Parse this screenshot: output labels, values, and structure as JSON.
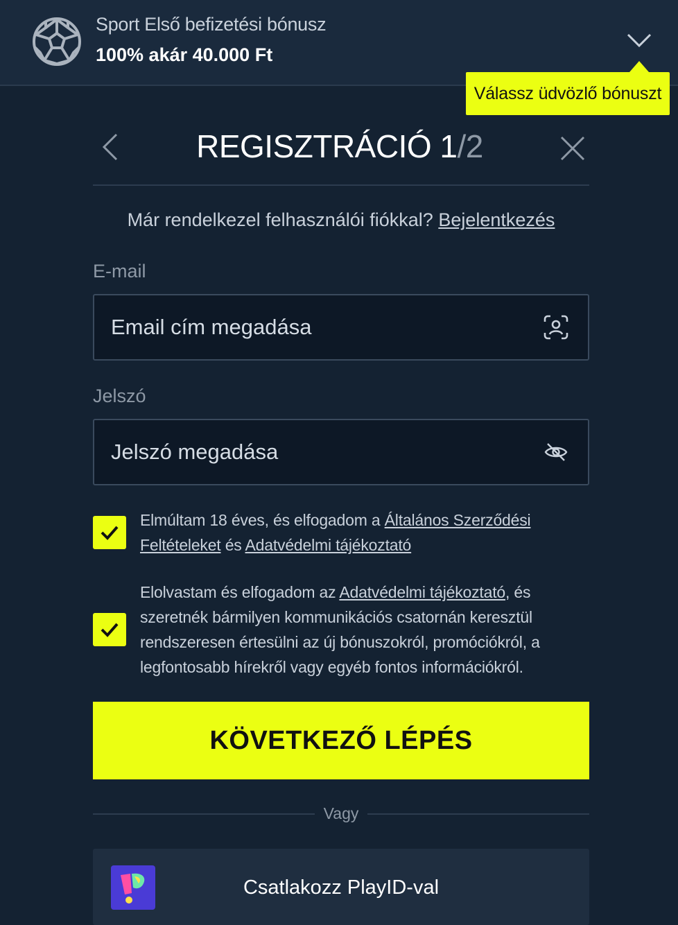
{
  "bonus_banner": {
    "title": "Sport Első befizetési bónusz",
    "amount": "100% akár 40.000 Ft",
    "icon": "soccer-ball-icon",
    "expand_icon": "chevron-down-icon"
  },
  "tooltip": {
    "text": "Válassz üdvözlő bónuszt"
  },
  "header": {
    "title_main": "REGISZTRÁCIÓ 1",
    "title_total": "/2",
    "back_icon": "chevron-left-icon",
    "close_icon": "close-icon"
  },
  "login_prompt": {
    "text": "Már rendelkezel felhasználói fiókkal?",
    "link": "Bejelentkezés"
  },
  "email": {
    "label": "E-mail",
    "placeholder": "Email cím megadása",
    "icon": "face-scan-icon"
  },
  "password": {
    "label": "Jelszó",
    "placeholder": "Jelszó megadása",
    "icon": "eye-off-icon"
  },
  "consents": [
    {
      "checked": true,
      "text_before": "Elmúltam 18 éves, és elfogadom a",
      "link1": "Általános Szerződési Feltételeket",
      "text_middle": "és",
      "link2": "Adatvédelmi tájékoztató"
    },
    {
      "checked": true,
      "text_before": "Elolvastam és elfogadom az",
      "link1": "Adatvédelmi tájékoztató",
      "text_after": ", és szeretnék bármilyen kommunikációs csatornán keresztül rendszeresen értesülni az új bónuszokról, promóciókról, a legfontosabb hírekről vagy egyéb fontos információkról."
    }
  ],
  "next_button": {
    "label": "KÖVETKEZŐ LÉPÉS"
  },
  "separator": {
    "text": "Vagy"
  },
  "playid": {
    "label": "Csatlakozz PlayID-val",
    "logo": "playid-logo"
  },
  "colors": {
    "background": "#142232",
    "accent": "#ebff12",
    "banner": "#1a2a3d",
    "input_bg": "#0d1826"
  }
}
